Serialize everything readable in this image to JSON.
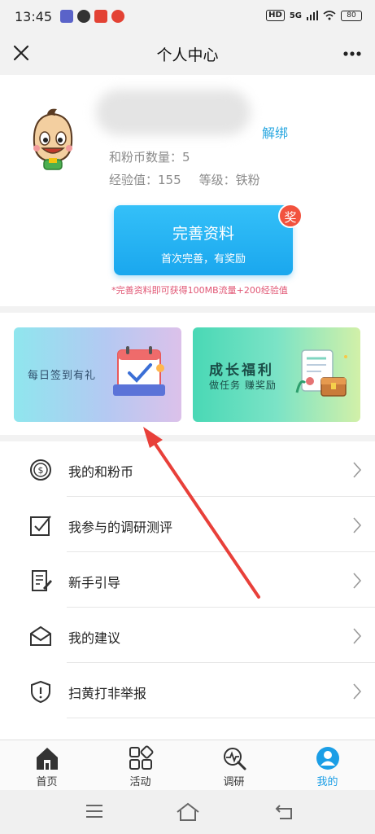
{
  "status_bar": {
    "time": "13:45",
    "hd": "HD",
    "signal": "5G",
    "battery": "80"
  },
  "nav": {
    "title": "个人中心"
  },
  "profile": {
    "unbind_label": "解绑",
    "coins_label": "和粉币数量：",
    "coins_value": "5",
    "exp_label": "经验值：",
    "exp_value": "155",
    "level_label": "等级：",
    "level_value": "铁粉",
    "complete_title": "完善资料",
    "complete_subtitle": "首次完善，有奖励",
    "reward_badge": "奖",
    "hint": "*完善资料即可获得100MB流量+200经验值"
  },
  "cards": {
    "checkin_label": "每日签到有礼",
    "growth_title": "成长福利",
    "growth_subtitle": "做任务 赚奖励"
  },
  "menu": {
    "items": [
      {
        "label": "我的和粉币",
        "icon": "coin-icon"
      },
      {
        "label": "我参与的调研测评",
        "icon": "survey-check-icon"
      },
      {
        "label": "新手引导",
        "icon": "guide-doc-icon"
      },
      {
        "label": "我的建议",
        "icon": "envelope-icon"
      },
      {
        "label": "扫黄打非举报",
        "icon": "shield-alert-icon"
      }
    ]
  },
  "tabbar": {
    "tabs": [
      {
        "label": "首页",
        "icon": "home-icon"
      },
      {
        "label": "活动",
        "icon": "grid-icon"
      },
      {
        "label": "调研",
        "icon": "research-icon"
      },
      {
        "label": "我的",
        "icon": "user-icon"
      }
    ],
    "active": "我的"
  },
  "colors": {
    "accent": "#1b9ee6",
    "button": "#25b3f3",
    "badge": "#f2523e",
    "hint": "#e05573",
    "arrow": "#e8403a"
  }
}
